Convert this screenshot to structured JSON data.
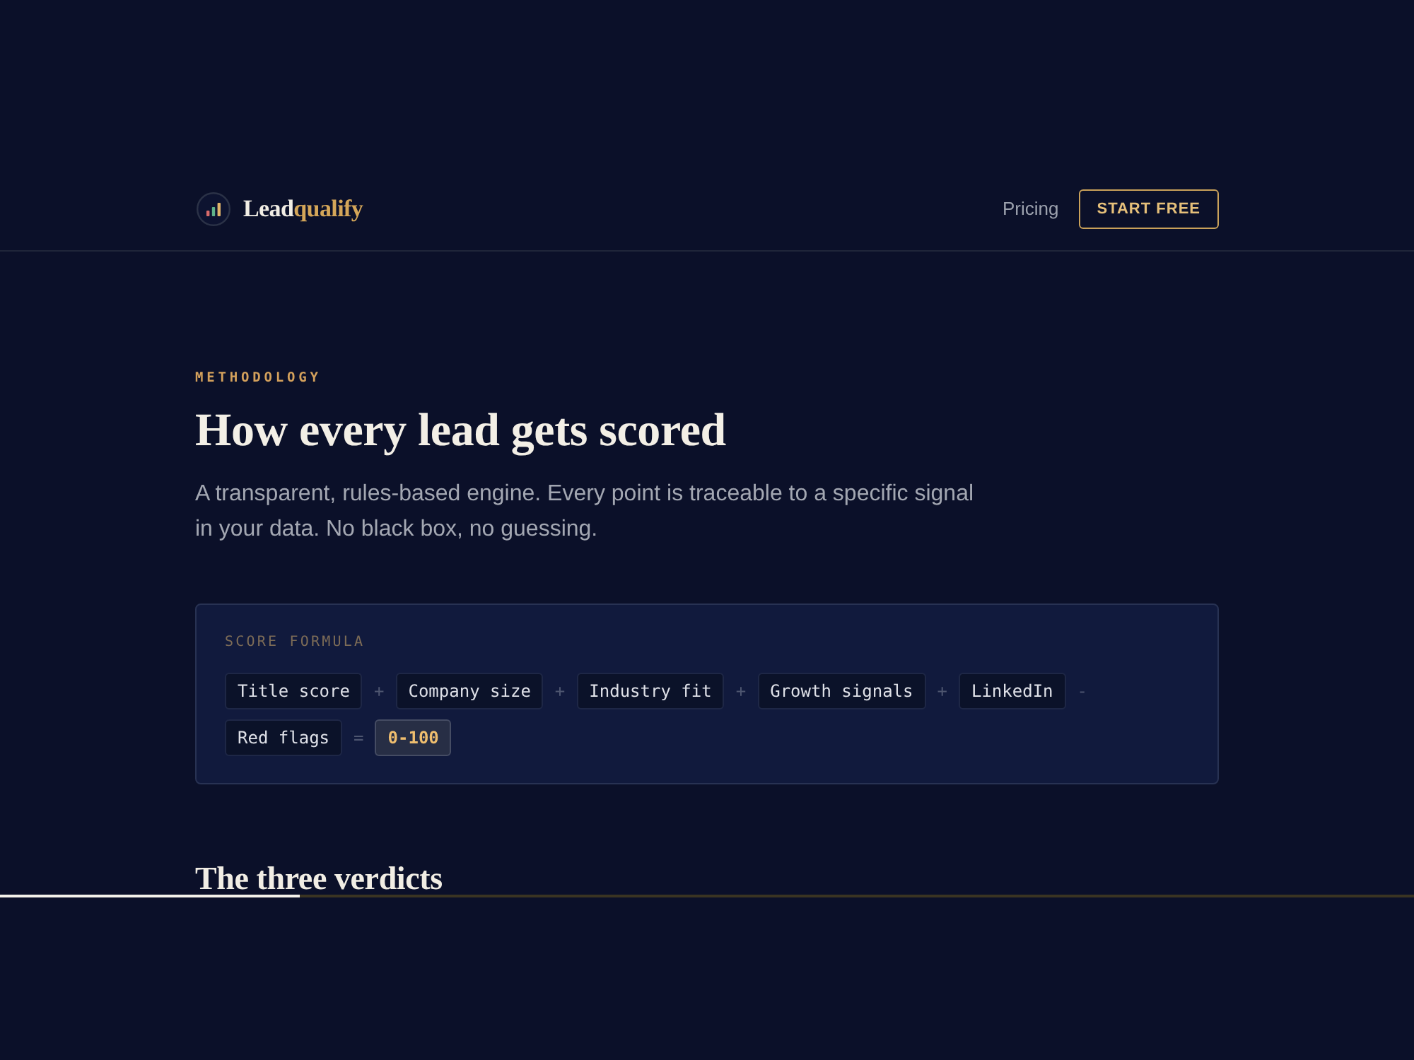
{
  "header": {
    "logo": {
      "brand_first": "Lead",
      "brand_second": "qualify"
    },
    "nav": [
      {
        "kind": "link",
        "label": "Pricing"
      },
      {
        "kind": "button",
        "label": "START FREE"
      }
    ]
  },
  "hero": {
    "eyebrow": "METHODOLOGY",
    "title": "How every lead gets scored",
    "lead": "A transparent, rules-based engine. Every point is traceable to a specific signal in your data. No black box, no guessing."
  },
  "formula": {
    "label": "SCORE FORMULA",
    "parts": [
      {
        "kind": "term",
        "text": "Title score"
      },
      {
        "kind": "operator",
        "text": "+"
      },
      {
        "kind": "term",
        "text": "Company size"
      },
      {
        "kind": "operator",
        "text": "+"
      },
      {
        "kind": "term",
        "text": "Industry fit"
      },
      {
        "kind": "operator",
        "text": "+"
      },
      {
        "kind": "term",
        "text": "Growth signals"
      },
      {
        "kind": "operator",
        "text": "+"
      },
      {
        "kind": "term",
        "text": "LinkedIn"
      },
      {
        "kind": "operator",
        "text": "-"
      },
      {
        "kind": "term",
        "text": "Red flags"
      },
      {
        "kind": "operator",
        "text": "="
      },
      {
        "kind": "result",
        "text": "0-100"
      }
    ]
  },
  "section": {
    "title": "The three verdicts"
  },
  "progress": {
    "level": 0.212
  }
}
